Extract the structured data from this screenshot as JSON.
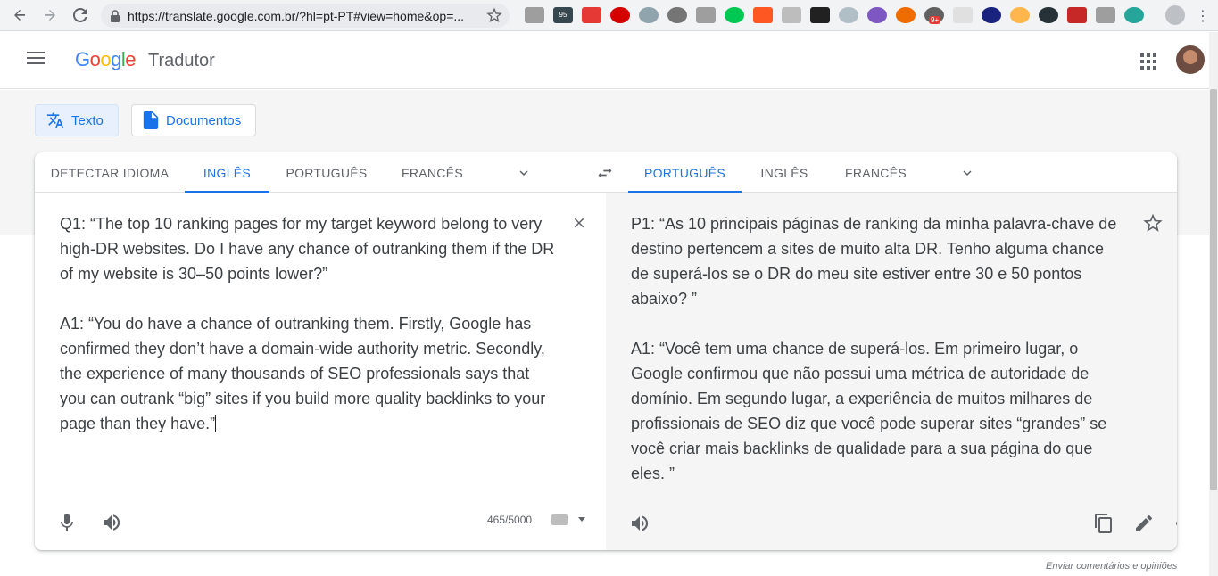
{
  "browser": {
    "url": "https://translate.google.com.br/?hl=pt-PT#view=home&op=...",
    "badge": "9+",
    "ext_badge": "95"
  },
  "header": {
    "logo": [
      "G",
      "o",
      "o",
      "g",
      "l",
      "e"
    ],
    "product": "Tradutor"
  },
  "modes": {
    "text": "Texto",
    "documents": "Documentos"
  },
  "source_langs": [
    "DETECTAR IDIOMA",
    "INGLÊS",
    "PORTUGUÊS",
    "FRANCÊS"
  ],
  "target_langs": [
    "PORTUGUÊS",
    "INGLÊS",
    "FRANCÊS"
  ],
  "source_text": "Q1: “The top 10 ranking pages for my target keyword belong to very high-DR websites. Do I have any chance of outranking them if the DR of my website is 30–50 points lower?”\n\nA1: “You do have a chance of outranking them. Firstly, Google has confirmed they don’t have a domain-wide authority metric. Secondly, the experience of many thousands of SEO professionals says that you can outrank “big” sites if you build more quality backlinks to your page than they have.”",
  "target_text": "P1: “As 10 principais páginas de ranking da minha palavra-chave de destino pertencem a sites de muito alta DR. Tenho alguma chance de superá-los se o DR do meu site estiver entre 30 e 50 pontos abaixo? ”\n\nA1: “Você tem uma chance de superá-los. Em primeiro lugar, o Google confirmou que não possui uma métrica de autoridade de domínio. Em segundo lugar, a experiência de muitos milhares de profissionais de SEO diz que você pode superar sites “grandes” se você criar mais backlinks de qualidade para a sua página do que eles. ”",
  "char_count": "465/5000",
  "feedback": "Enviar comentários e opiniões",
  "colors": {
    "accent": "#1a73e8",
    "target_bg": "#f5f5f5"
  }
}
